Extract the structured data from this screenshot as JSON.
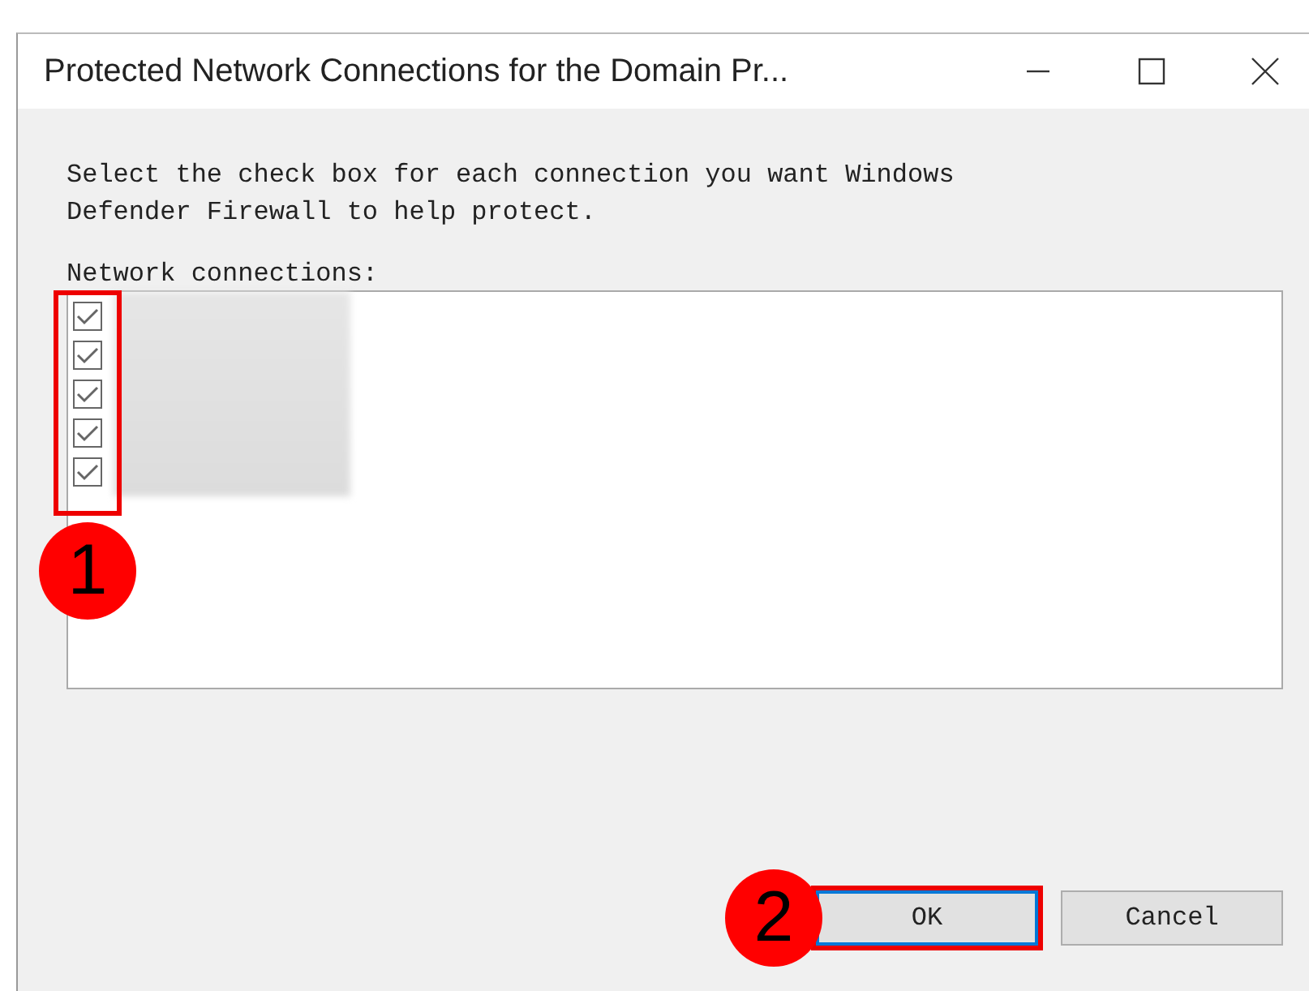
{
  "window": {
    "title": "Protected Network Connections for the Domain Pr..."
  },
  "instructions": "Select the check box for each connection you want Windows Defender Firewall to help protect.",
  "list_label": "Network connections:",
  "connections": [
    {
      "checked": true
    },
    {
      "checked": true
    },
    {
      "checked": true
    },
    {
      "checked": true
    },
    {
      "checked": true
    }
  ],
  "buttons": [
    {
      "label": "OK",
      "kind": "default",
      "step": "2"
    },
    {
      "label": "Cancel",
      "kind": "normal"
    }
  ],
  "steps": [
    {
      "number": "1"
    }
  ]
}
